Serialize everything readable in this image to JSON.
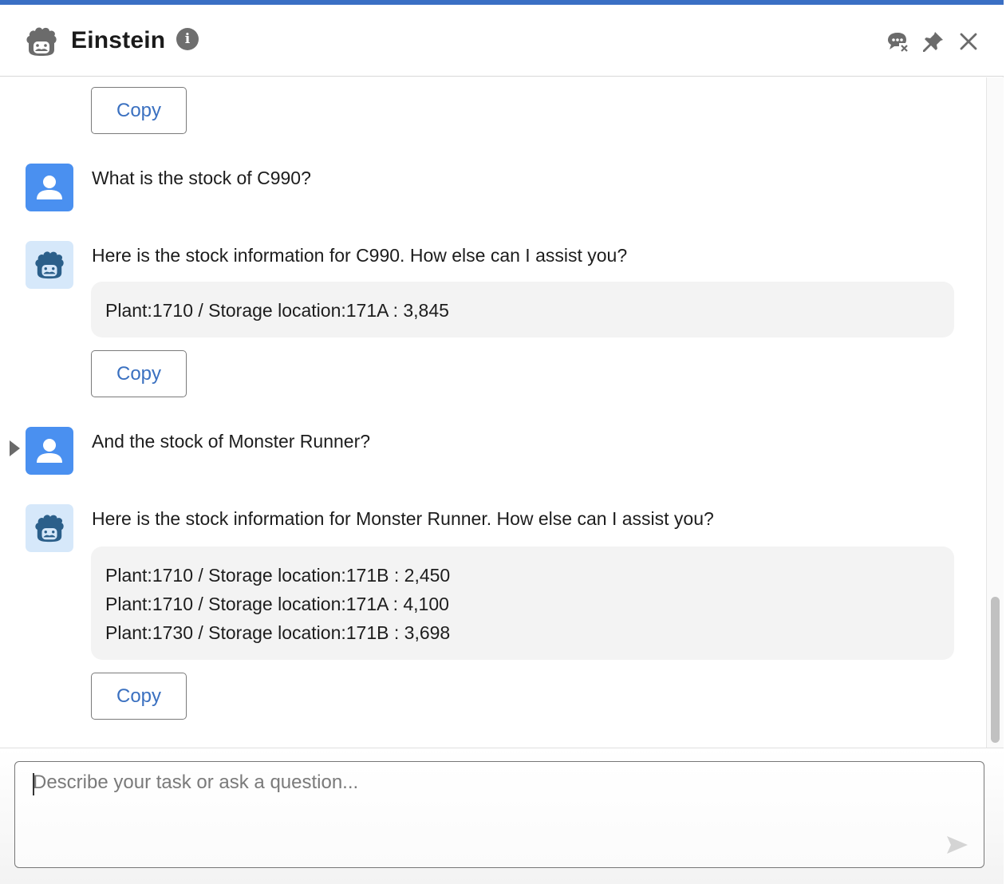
{
  "header": {
    "title": "Einstein",
    "icons": {
      "logo": "einstein-logo-icon",
      "info": "info-icon",
      "end_chat": "chat-end-icon",
      "pin": "pin-icon",
      "close": "close-icon"
    },
    "info_glyph": "i"
  },
  "conversation": [
    {
      "type": "copy",
      "label": "Copy"
    },
    {
      "type": "user",
      "text": "What is the stock of C990?"
    },
    {
      "type": "bot",
      "text": "Here is the stock information for C990. How else can I assist you?",
      "results": [
        "Plant:1710 / Storage location:171A : 3,845"
      ],
      "copy_label": "Copy"
    },
    {
      "type": "user",
      "text": "And the stock of Monster Runner?"
    },
    {
      "type": "bot",
      "text": "Here is the stock information for Monster Runner. How else can I assist you?",
      "results": [
        "Plant:1710 / Storage location:171B : 2,450",
        "Plant:1710 / Storage location:171A : 4,100",
        "Plant:1730 / Storage location:171B : 3,698"
      ],
      "copy_label": "Copy"
    }
  ],
  "composer": {
    "placeholder": "Describe your task or ask a question...",
    "value": ""
  },
  "colors": {
    "accent": "#3a6fc4",
    "user_avatar": "#4a90f0",
    "bot_avatar_bg": "#d6e8fa",
    "copy_text": "#3a70c0",
    "result_bg": "#f3f3f3"
  }
}
